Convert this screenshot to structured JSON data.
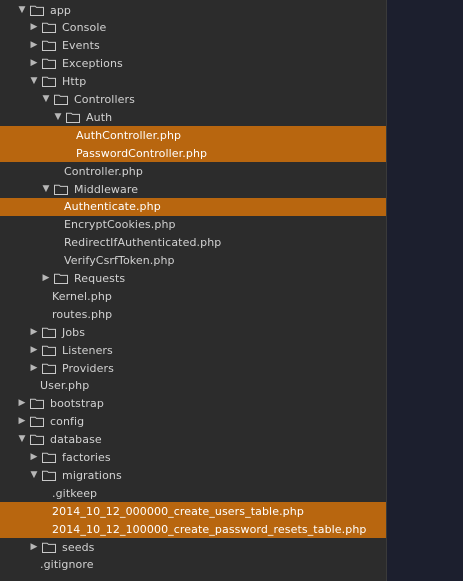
{
  "tree": [
    {
      "label": "app",
      "type": "folder",
      "expanded": true,
      "depth": 0
    },
    {
      "label": "Console",
      "type": "folder",
      "expanded": false,
      "depth": 1
    },
    {
      "label": "Events",
      "type": "folder",
      "expanded": false,
      "depth": 1
    },
    {
      "label": "Exceptions",
      "type": "folder",
      "expanded": false,
      "depth": 1
    },
    {
      "label": "Http",
      "type": "folder",
      "expanded": true,
      "depth": 1
    },
    {
      "label": "Controllers",
      "type": "folder",
      "expanded": true,
      "depth": 2
    },
    {
      "label": "Auth",
      "type": "folder",
      "expanded": true,
      "depth": 3
    },
    {
      "label": "AuthController.php",
      "type": "file",
      "depth": 4,
      "selected": true
    },
    {
      "label": "PasswordController.php",
      "type": "file",
      "depth": 4,
      "selected": true
    },
    {
      "label": "Controller.php",
      "type": "file",
      "depth": 3
    },
    {
      "label": "Middleware",
      "type": "folder",
      "expanded": true,
      "depth": 2
    },
    {
      "label": "Authenticate.php",
      "type": "file",
      "depth": 3,
      "selected": true
    },
    {
      "label": "EncryptCookies.php",
      "type": "file",
      "depth": 3
    },
    {
      "label": "RedirectIfAuthenticated.php",
      "type": "file",
      "depth": 3
    },
    {
      "label": "VerifyCsrfToken.php",
      "type": "file",
      "depth": 3
    },
    {
      "label": "Requests",
      "type": "folder",
      "expanded": false,
      "depth": 2
    },
    {
      "label": "Kernel.php",
      "type": "file",
      "depth": 2
    },
    {
      "label": "routes.php",
      "type": "file",
      "depth": 2
    },
    {
      "label": "Jobs",
      "type": "folder",
      "expanded": false,
      "depth": 1
    },
    {
      "label": "Listeners",
      "type": "folder",
      "expanded": false,
      "depth": 1
    },
    {
      "label": "Providers",
      "type": "folder",
      "expanded": false,
      "depth": 1
    },
    {
      "label": "User.php",
      "type": "file",
      "depth": 1
    },
    {
      "label": "bootstrap",
      "type": "folder",
      "expanded": false,
      "depth": 0
    },
    {
      "label": "config",
      "type": "folder",
      "expanded": false,
      "depth": 0
    },
    {
      "label": "database",
      "type": "folder",
      "expanded": true,
      "depth": 0
    },
    {
      "label": "factories",
      "type": "folder",
      "expanded": false,
      "depth": 1
    },
    {
      "label": "migrations",
      "type": "folder",
      "expanded": true,
      "depth": 1
    },
    {
      "label": ".gitkeep",
      "type": "file",
      "depth": 2
    },
    {
      "label": "2014_10_12_000000_create_users_table.php",
      "type": "file",
      "depth": 2,
      "selected": true
    },
    {
      "label": "2014_10_12_100000_create_password_resets_table.php",
      "type": "file",
      "depth": 2,
      "selected": true
    },
    {
      "label": "seeds",
      "type": "folder",
      "expanded": false,
      "depth": 1
    },
    {
      "label": ".gitignore",
      "type": "file",
      "depth": 1
    }
  ],
  "colors": {
    "selection": "#b8660f",
    "sidebar_bg": "#2c2c2c",
    "editor_bg": "#1c1f2e",
    "text": "#d2d2d2"
  },
  "icons": {
    "expanded": "triangle-down-icon",
    "collapsed": "triangle-right-icon",
    "folder": "folder-icon"
  }
}
